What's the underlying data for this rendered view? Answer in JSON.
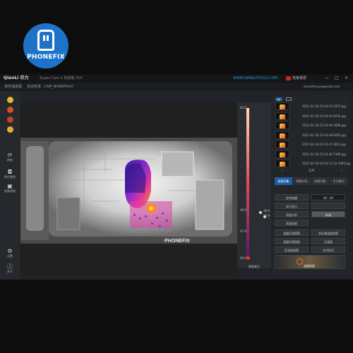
{
  "logo": {
    "brand": "PHONEFIX"
  },
  "titlebar": {
    "app_name": "QianLi 巨力",
    "subtitle": "Super Cam X 热成像 V10",
    "url": "WWW.QIANLITOOLS.COM",
    "record_label": "热像录屏",
    "window_controls": [
      "—",
      "□",
      "✕"
    ]
  },
  "menubar": {
    "items": [
      "保存温度图",
      "自动校准",
      "CAM_N4NDFRUV"
    ],
    "email": "zhenzhenyue@email.com"
  },
  "leftbar": {
    "palette_colors": [
      "#e8b830",
      "#d94f1e",
      "#c2402b",
      "#e9a93a"
    ],
    "buttons": [
      {
        "icon": "refresh-icon",
        "label": "刷新"
      },
      {
        "icon": "camera-icon",
        "label": "图片截图"
      },
      {
        "icon": "video-icon",
        "label": "图像录制"
      },
      {
        "icon": "settings-icon",
        "label": "设置"
      },
      {
        "icon": "info-icon",
        "label": "关于"
      }
    ]
  },
  "viewer": {
    "watermark": "PHONEFIX"
  },
  "scale": {
    "top_temp": "42.0",
    "mid_temp": "30.9",
    "low_temp": "27.9",
    "bottom_temp": "20.0",
    "reading_high": "30.9",
    "reading_low": "27.9",
    "reset_label": "数据复位"
  },
  "right_panel": {
    "files": [
      "2021-02-18-15-04-51-2972.jpg",
      "2021-02-18-15-04-50-0593.jpg",
      "2021-02-18-15-04-49-5068.jpg",
      "2021-02-18-15-04-48-6063.jpg",
      "2021-02-18-15-04-47-4823.jpg",
      "2021-02-18-15-04-46-7496.jpg",
      "2021-02-18-15-04-11-02-2960.jpg"
    ],
    "pager": "1/4",
    "tabs": [
      "画面功能",
      "模糊分析",
      "图像功能",
      "专业模式"
    ],
    "time_value": "00 : 00",
    "buttons": [
      "定时拍摄",
      "",
      "标尺显示",
      "",
      "测温分析",
      "标温",
      "高温追踪",
      "",
      "温度区域观察",
      "多区域温度观察",
      "温度区域温差",
      "点温度",
      "区域温度图",
      "文字标识"
    ],
    "bottom_button": "温度校准"
  }
}
